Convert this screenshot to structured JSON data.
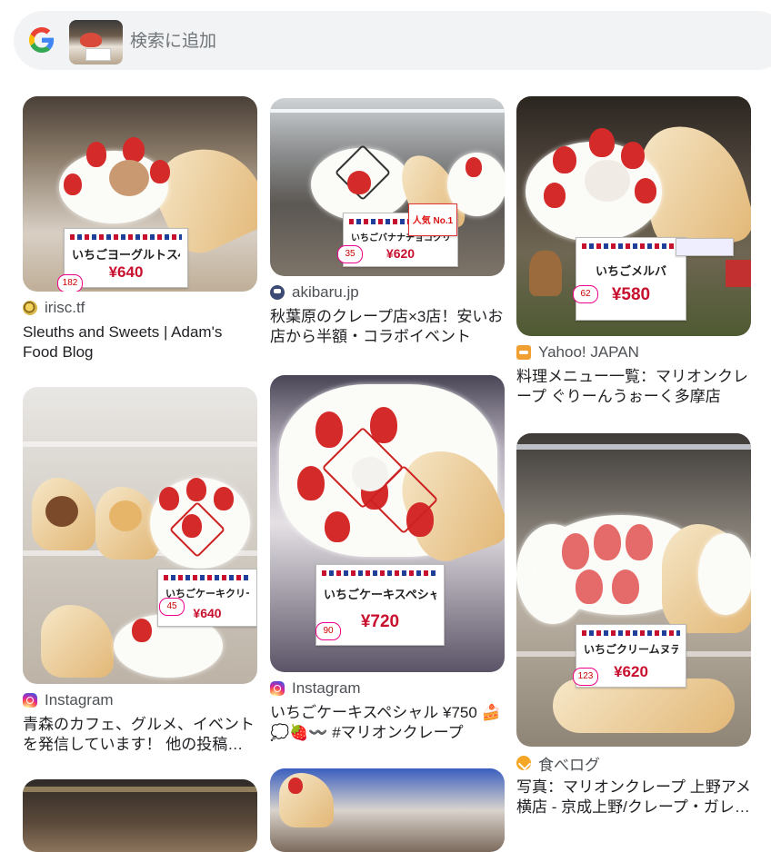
{
  "search": {
    "placeholder": "検索に追加"
  },
  "colors": {
    "search_bg": "#f1f3f4",
    "source_text": "#4d5156",
    "title_text": "#202124"
  },
  "results": [
    {
      "source": "irisc.tf",
      "source_icon": "snail-favicon-icon",
      "title": "Sleuths and Sweets | Adam's Food Blog",
      "image_sign": {
        "name": "いちごヨーグルトスペシャル",
        "price": "¥640",
        "number": "182"
      }
    },
    {
      "source": "akibaru.jp",
      "source_icon": "akibaru-favicon-icon",
      "title": "秋葉原のクレープ店×3店！安いお店から半額・コラボイベント",
      "image_sign": {
        "name": "いちごバナナチョコクリーム",
        "price": "¥620",
        "number": "35",
        "badge": "人気 No.1"
      }
    },
    {
      "source": "Yahoo! JAPAN",
      "source_icon": "yahoo-favicon-icon",
      "title": "料理メニュー一覧：マリオンクレープ ぐりーんうぉーく多摩店",
      "image_sign": {
        "name": "いちごメルバ",
        "price": "¥580",
        "number": "62"
      }
    },
    {
      "source": "Instagram",
      "source_icon": "instagram-icon",
      "title": "青森のカフェ、グルメ、イベントを発信しています！ 他の投稿はこちら",
      "image_sign": {
        "name": "いちごケーキクリーム",
        "price": "¥640",
        "number": "45"
      }
    },
    {
      "source": "Instagram",
      "source_icon": "instagram-icon",
      "title": "いちごケーキスペシャル ¥750 🍰💭🍓〰️ #マリオンクレープ",
      "image_sign": {
        "name": "いちごケーキスペシャル",
        "price": "¥720",
        "number": "90"
      }
    },
    {
      "source": "食べログ",
      "source_icon": "tabelog-favicon-icon",
      "title": "写真：マリオンクレープ 上野アメ横店 - 京成上野/クレープ・ガレット",
      "image_sign": {
        "name": "いちごクリームヌテラ",
        "price": "¥620",
        "number": "123"
      }
    }
  ]
}
